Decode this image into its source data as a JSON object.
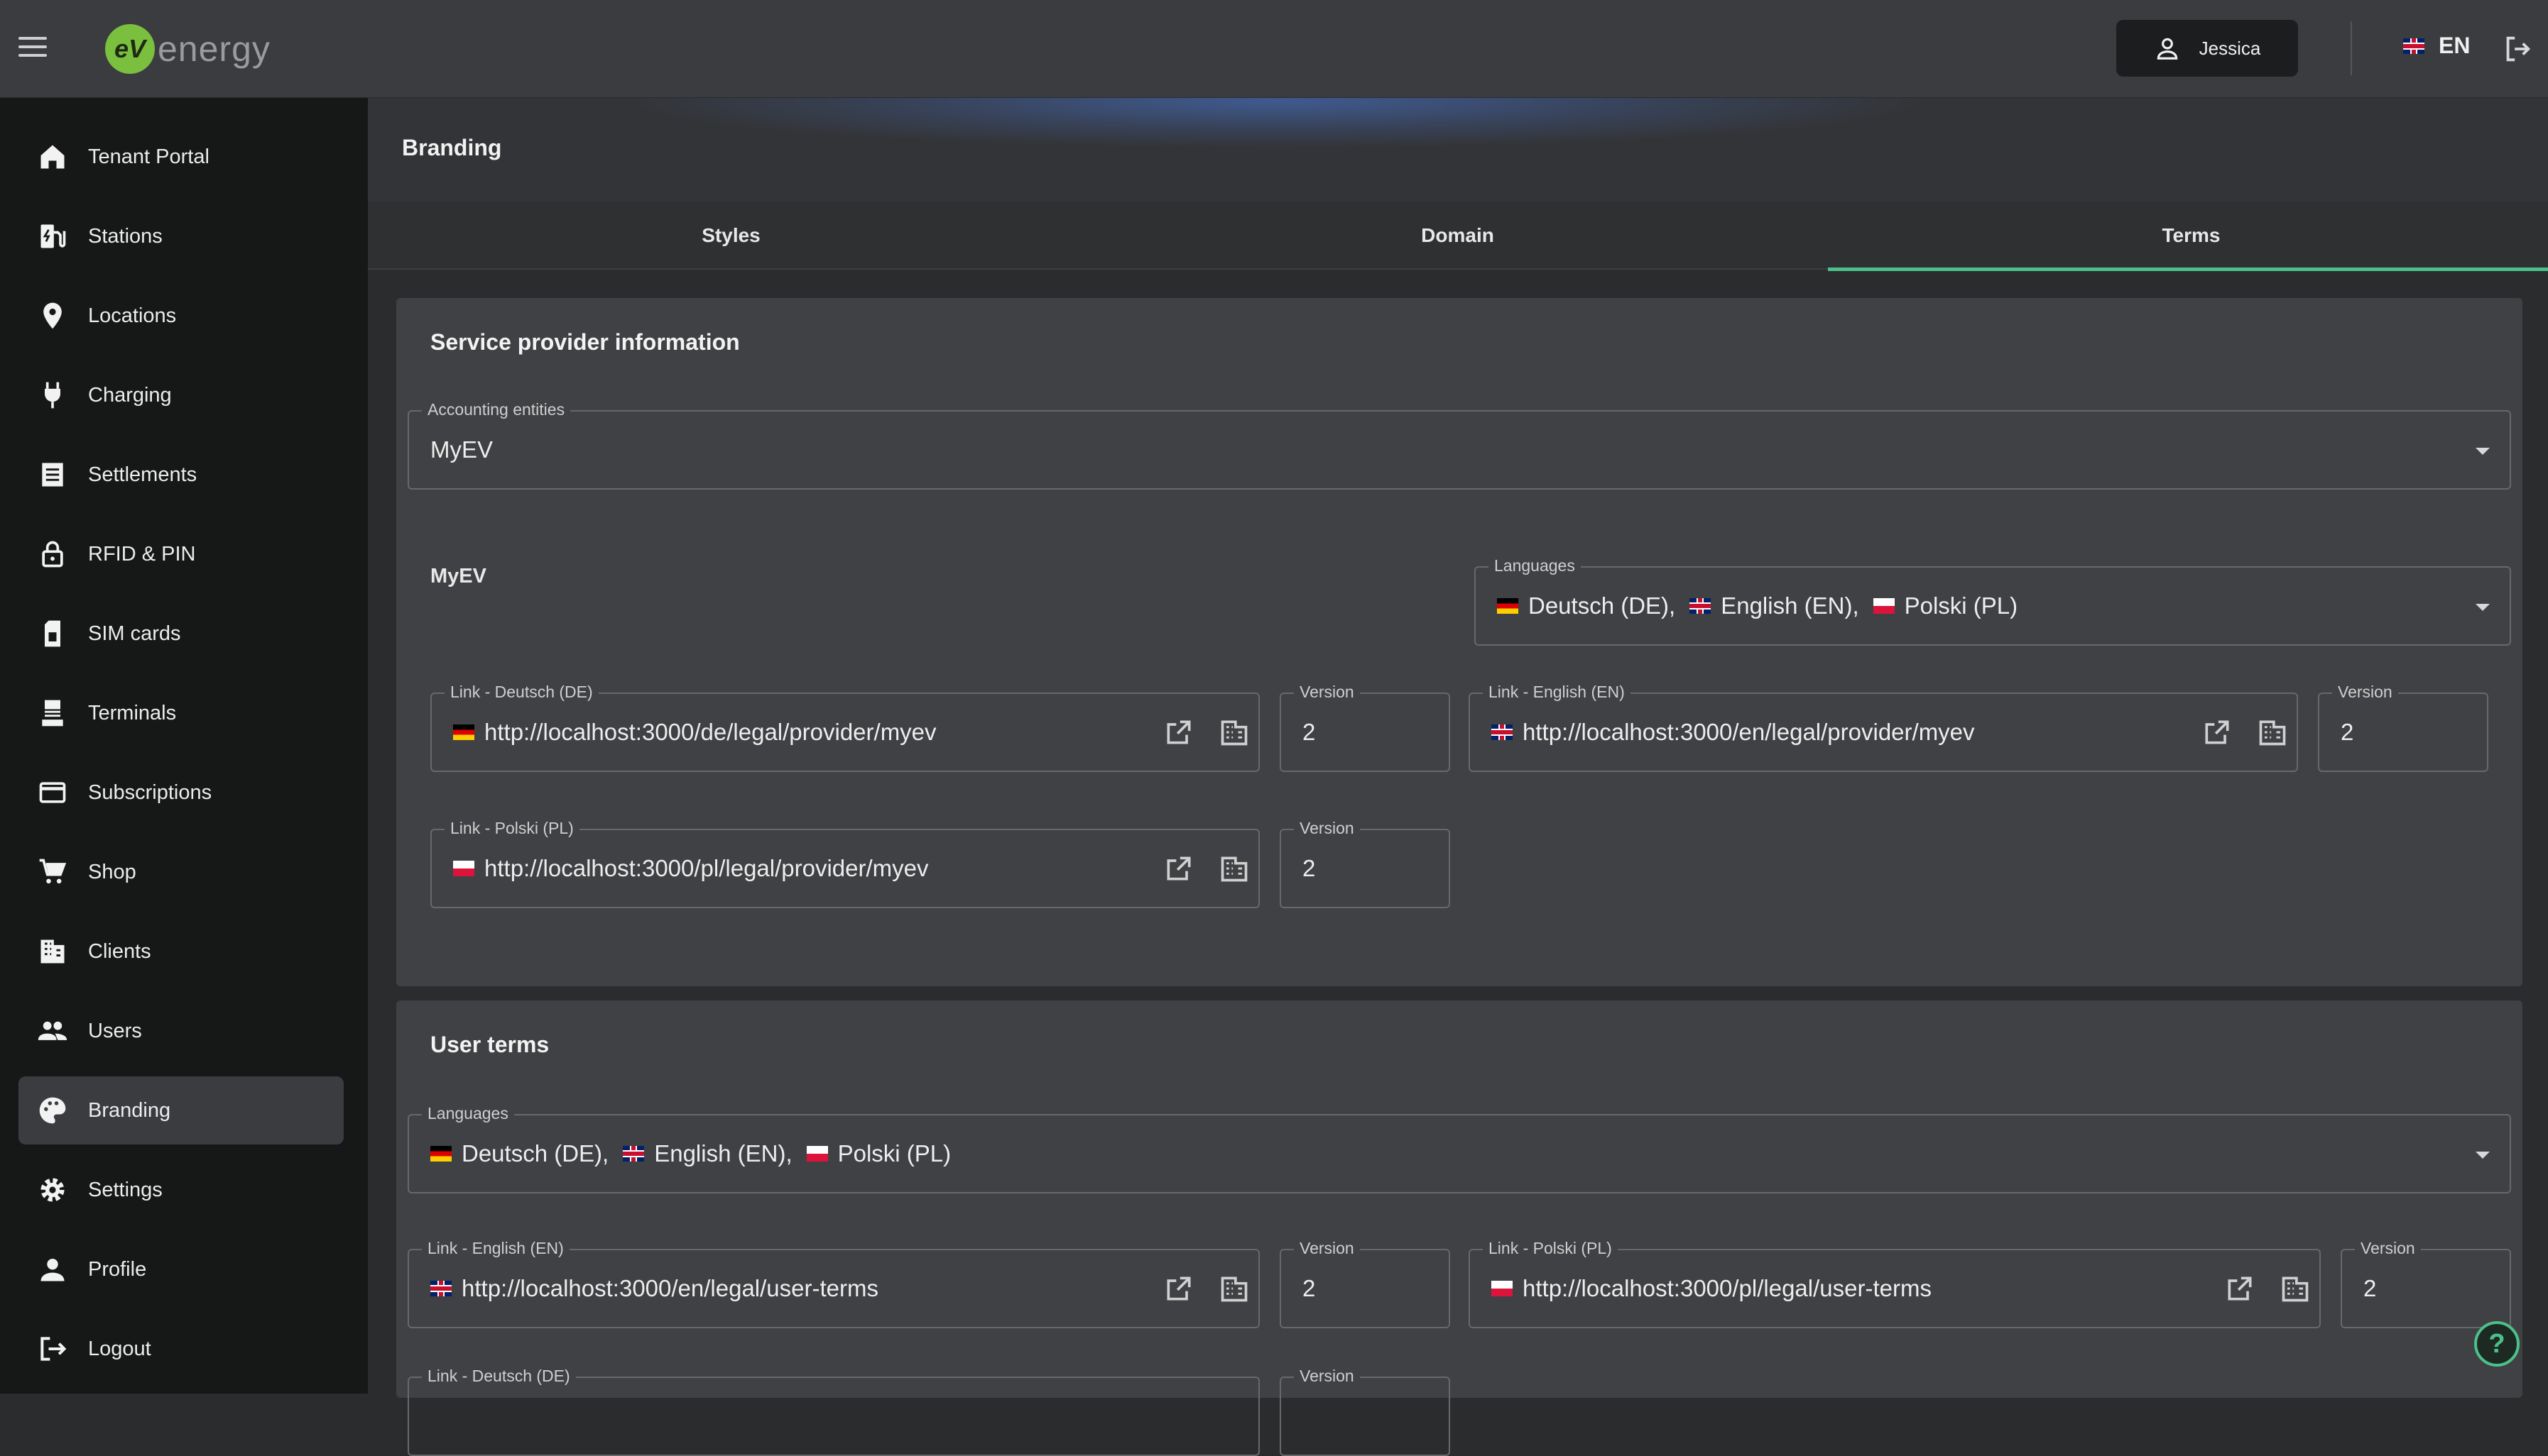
{
  "header": {
    "brand_letters": "eV",
    "brand_word": "energy",
    "user_name": "Jessica",
    "language_code": "EN"
  },
  "sidebar": {
    "items": [
      {
        "label": "Tenant Portal",
        "icon": "home-icon"
      },
      {
        "label": "Stations",
        "icon": "ev-station-icon"
      },
      {
        "label": "Locations",
        "icon": "location-pin-icon"
      },
      {
        "label": "Charging",
        "icon": "plug-icon"
      },
      {
        "label": "Settlements",
        "icon": "receipt-icon"
      },
      {
        "label": "RFID & PIN",
        "icon": "lock-icon"
      },
      {
        "label": "SIM cards",
        "icon": "sim-card-icon"
      },
      {
        "label": "Terminals",
        "icon": "terminal-icon"
      },
      {
        "label": "Subscriptions",
        "icon": "credit-card-icon"
      },
      {
        "label": "Shop",
        "icon": "cart-icon"
      },
      {
        "label": "Clients",
        "icon": "building-icon"
      },
      {
        "label": "Users",
        "icon": "users-icon"
      },
      {
        "label": "Branding",
        "icon": "palette-icon",
        "active": true
      },
      {
        "label": "Settings",
        "icon": "gear-icon"
      },
      {
        "label": "Profile",
        "icon": "person-icon"
      },
      {
        "label": "Logout",
        "icon": "logout-icon"
      }
    ]
  },
  "page": {
    "title": "Branding",
    "tabs": [
      "Styles",
      "Domain",
      "Terms"
    ],
    "active_tab": "Terms"
  },
  "service_provider": {
    "title": "Service provider information",
    "accounting_label": "Accounting entities",
    "accounting_value": "MyEV",
    "entity_name": "MyEV",
    "languages_label": "Languages",
    "languages": [
      "Deutsch (DE),",
      "English (EN),",
      "Polski (PL)"
    ],
    "links": [
      {
        "label": "Link - Deutsch (DE)",
        "url": "http://localhost:3000/de/legal/provider/myev",
        "flag": "de",
        "version_label": "Version",
        "version": "2"
      },
      {
        "label": "Link - English (EN)",
        "url": "http://localhost:3000/en/legal/provider/myev",
        "flag": "gb",
        "version_label": "Version",
        "version": "2"
      },
      {
        "label": "Link - Polski (PL)",
        "url": "http://localhost:3000/pl/legal/provider/myev",
        "flag": "pl",
        "version_label": "Version",
        "version": "2"
      }
    ]
  },
  "user_terms": {
    "title": "User terms",
    "languages_label": "Languages",
    "languages": [
      "Deutsch (DE),",
      "English (EN),",
      "Polski (PL)"
    ],
    "links": [
      {
        "label": "Link - English (EN)",
        "url": "http://localhost:3000/en/legal/user-terms",
        "flag": "gb",
        "version_label": "Version",
        "version": "2"
      },
      {
        "label": "Link - Polski (PL)",
        "url": "http://localhost:3000/pl/legal/user-terms",
        "flag": "pl",
        "version_label": "Version",
        "version": "2"
      },
      {
        "label": "Link - Deutsch (DE)",
        "url": "",
        "flag": "de",
        "version_label": "Version",
        "version": ""
      }
    ]
  },
  "help": {
    "glyph": "?"
  },
  "colors": {
    "accent": "#4cc08a",
    "brand": "#7bbf3f",
    "sidebar_bg": "#151817",
    "card_bg": "#404144"
  }
}
